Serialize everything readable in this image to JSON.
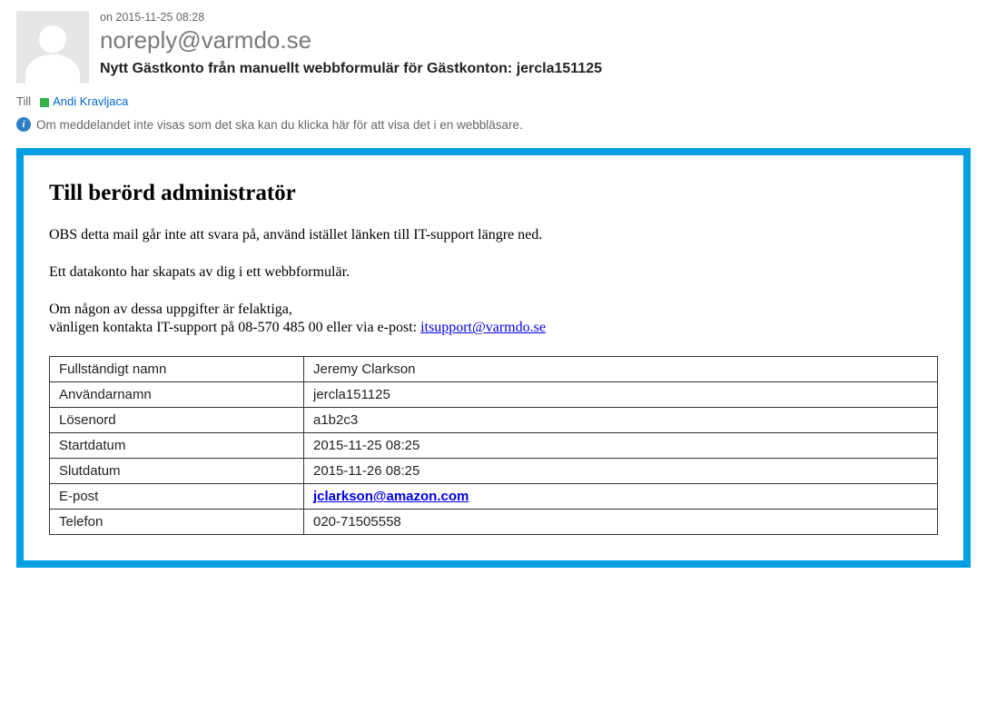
{
  "header": {
    "timestamp": "on 2015-11-25 08:28",
    "from": "noreply@varmdo.se",
    "subject": "Nytt Gästkonto från manuellt webbformulär för Gästkonton: jercla151125",
    "to_label": "Till",
    "recipient": "Andi Kravljaca"
  },
  "infobar": {
    "text": "Om meddelandet inte visas som det ska kan du klicka här för att visa det i en webbläsare."
  },
  "body": {
    "heading": "Till berörd administratör",
    "note": "OBS detta mail går inte att svara på, använd istället länken till IT-support längre ned.",
    "created": "Ett datakonto har skapats av dig i ett webbformulär.",
    "wrong1": "Om någon av dessa uppgifter är felaktiga,",
    "wrong2": "vänligen kontakta IT-support på 08-570 485 00 eller via e-post: ",
    "it_email": "itsupport@varmdo.se"
  },
  "account": {
    "rows": [
      {
        "label": "Fullständigt namn",
        "value": "Jeremy Clarkson",
        "link": false
      },
      {
        "label": "Användarnamn",
        "value": "jercla151125",
        "link": false
      },
      {
        "label": "Lösenord",
        "value": "a1b2c3",
        "link": false
      },
      {
        "label": "Startdatum",
        "value": "2015-11-25 08:25",
        "link": false
      },
      {
        "label": "Slutdatum",
        "value": "2015-11-26 08:25",
        "link": false
      },
      {
        "label": "E-post",
        "value": "jclarkson@amazon.com",
        "link": true
      },
      {
        "label": "Telefon",
        "value": "020-71505558",
        "link": false
      }
    ]
  }
}
